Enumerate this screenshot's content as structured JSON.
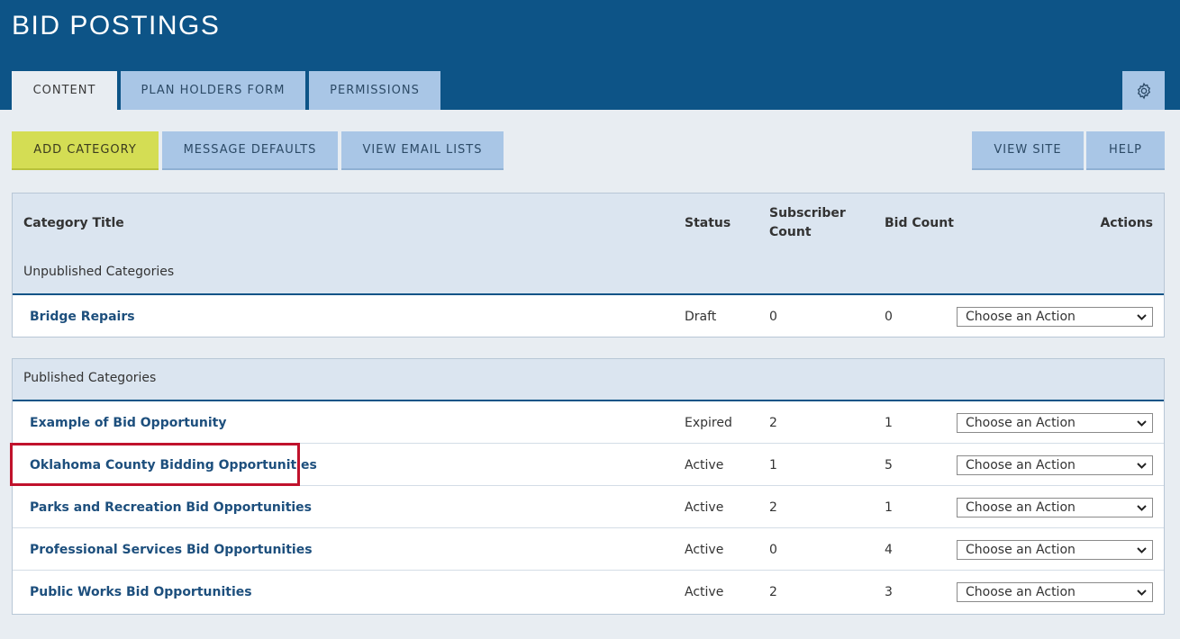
{
  "header": {
    "title": "BID POSTINGS",
    "tabs": [
      {
        "label": "CONTENT",
        "active": true
      },
      {
        "label": "PLAN HOLDERS FORM",
        "active": false
      },
      {
        "label": "PERMISSIONS",
        "active": false
      }
    ],
    "settings_icon": "gear-icon"
  },
  "toolbar": {
    "add_category": "ADD CATEGORY",
    "message_defaults": "MESSAGE DEFAULTS",
    "view_email_lists": "VIEW EMAIL LISTS",
    "view_site": "VIEW SITE",
    "help": "HELP"
  },
  "table": {
    "columns": {
      "title": "Category Title",
      "status": "Status",
      "subscriber_count_line1": "Subscriber",
      "subscriber_count_line2": "Count",
      "bid_count": "Bid Count",
      "actions": "Actions"
    },
    "unpublished": {
      "label": "Unpublished Categories",
      "rows": [
        {
          "title": "Bridge Repairs",
          "status": "Draft",
          "subscribers": "0",
          "bids": "0",
          "action": "Choose an Action"
        }
      ]
    },
    "published": {
      "label": "Published Categories",
      "rows": [
        {
          "title": "Example of Bid Opportunity",
          "status": "Expired",
          "subscribers": "2",
          "bids": "1",
          "action": "Choose an Action"
        },
        {
          "title": "Oklahoma County Bidding Opportunities",
          "status": "Active",
          "subscribers": "1",
          "bids": "5",
          "action": "Choose an Action"
        },
        {
          "title": "Parks and Recreation Bid Opportunities",
          "status": "Active",
          "subscribers": "2",
          "bids": "1",
          "action": "Choose an Action"
        },
        {
          "title": "Professional Services Bid Opportunities",
          "status": "Active",
          "subscribers": "0",
          "bids": "4",
          "action": "Choose an Action"
        },
        {
          "title": "Public Works Bid Opportunities",
          "status": "Active",
          "subscribers": "2",
          "bids": "3",
          "action": "Choose an Action"
        }
      ]
    }
  },
  "colors": {
    "header_bg": "#0d5487",
    "tab_bg": "#a9c6e6",
    "primary_button": "#d4dd54",
    "highlight_border": "#c0122c",
    "link_text": "#1d4f7d"
  }
}
